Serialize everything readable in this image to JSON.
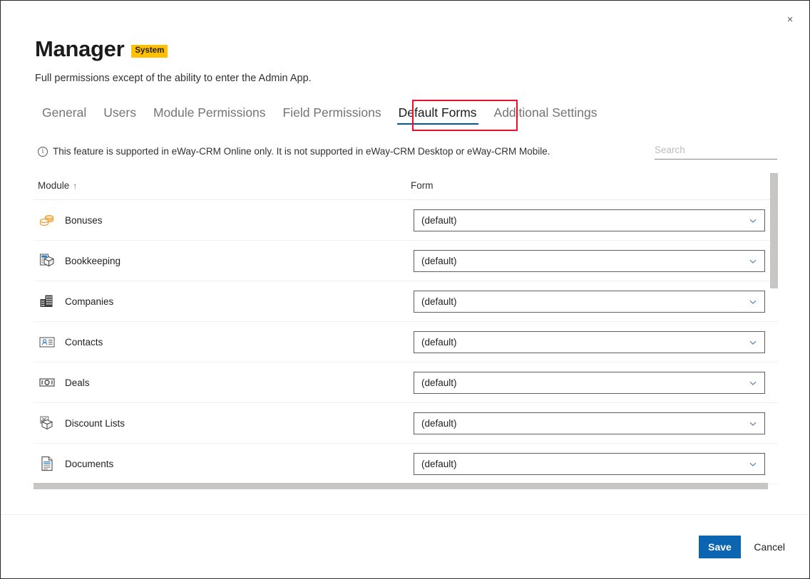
{
  "window": {
    "close_label": "×"
  },
  "header": {
    "title": "Manager",
    "badge": "System",
    "subtitle": "Full permissions except of the ability to enter the Admin App."
  },
  "tabs": [
    {
      "label": "General",
      "active": false
    },
    {
      "label": "Users",
      "active": false
    },
    {
      "label": "Module Permissions",
      "active": false
    },
    {
      "label": "Field Permissions",
      "active": false
    },
    {
      "label": "Default Forms",
      "active": true
    },
    {
      "label": "Additional Settings",
      "active": false
    }
  ],
  "info": {
    "icon": "info-circle-icon",
    "text": "This feature is supported in eWay-CRM Online only. It is not supported in eWay-CRM Desktop or eWay-CRM Mobile."
  },
  "search": {
    "value": "",
    "placeholder": "Search"
  },
  "table": {
    "columns": [
      {
        "label": "Module",
        "sort": "↑"
      },
      {
        "label": "Form",
        "sort": ""
      }
    ],
    "rows": [
      {
        "module": "Bonuses",
        "icon": "bonuses-icon",
        "form": "(default)"
      },
      {
        "module": "Bookkeeping",
        "icon": "bookkeeping-icon",
        "form": "(default)"
      },
      {
        "module": "Companies",
        "icon": "companies-icon",
        "form": "(default)"
      },
      {
        "module": "Contacts",
        "icon": "contacts-icon",
        "form": "(default)"
      },
      {
        "module": "Deals",
        "icon": "deals-icon",
        "form": "(default)"
      },
      {
        "module": "Discount Lists",
        "icon": "discount-lists-icon",
        "form": "(default)"
      },
      {
        "module": "Documents",
        "icon": "documents-icon",
        "form": "(default)"
      }
    ]
  },
  "footer": {
    "save_label": "Save",
    "cancel_label": "Cancel"
  },
  "colors": {
    "accent": "#0c65b0",
    "tab_underline": "#005a9e",
    "badge_bg": "#FFC000",
    "annotation": "#e8112d",
    "scrollbar": "#c8c6c4"
  }
}
